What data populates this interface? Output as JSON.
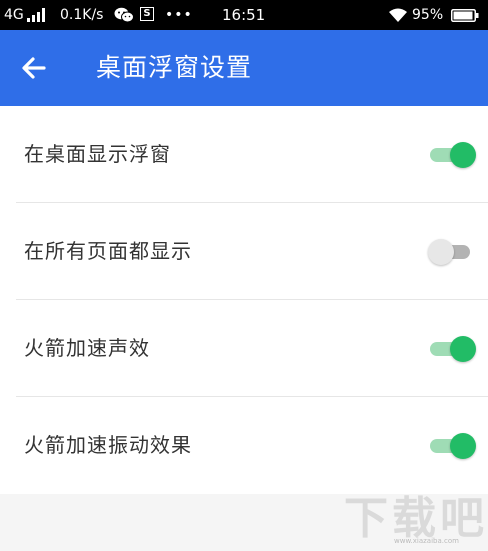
{
  "status_bar": {
    "signal": "4G",
    "speed": "0.1K/s",
    "s_icon": "S",
    "more": "•••",
    "time": "16:51",
    "battery": "95%"
  },
  "app_bar": {
    "title": "桌面浮窗设置"
  },
  "settings": [
    {
      "label": "在桌面显示浮窗",
      "on": true
    },
    {
      "label": "在所有页面都显示",
      "on": false
    },
    {
      "label": "火箭加速声效",
      "on": true
    },
    {
      "label": "火箭加速振动效果",
      "on": true
    }
  ],
  "colors": {
    "accent": "#2f6ee8",
    "switch_on": "#22bc66",
    "switch_off": "#e7e7e7"
  },
  "watermark": {
    "text": "下载吧",
    "url": "www.xiazaiba.com"
  }
}
